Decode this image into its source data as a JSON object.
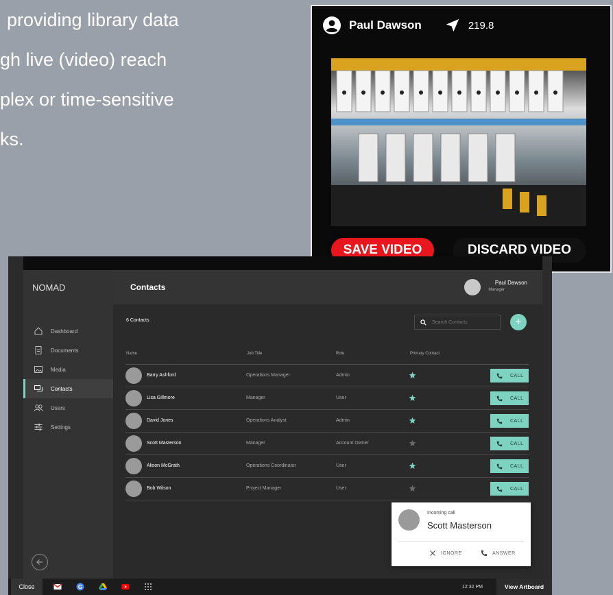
{
  "intro": {
    "lines": [
      "providing library data",
      "gh live (video) reach",
      "plex or time-sensitive",
      "ks."
    ]
  },
  "video": {
    "user_name": "Paul Dawson",
    "distance": "219.8",
    "save_label": "SAVE VIDEO",
    "discard_label": "DISCARD VIDEO",
    "icons": [
      "account-circle-icon",
      "navigation-arrow-icon"
    ]
  },
  "app": {
    "brand": "NOMAD",
    "page_title": "Contacts",
    "user": {
      "name": "Paul Dawson",
      "role": "Manager"
    },
    "nav": [
      {
        "label": "Dashboard",
        "icon": "home-icon"
      },
      {
        "label": "Documents",
        "icon": "document-icon"
      },
      {
        "label": "Media",
        "icon": "image-icon"
      },
      {
        "label": "Contacts",
        "icon": "chat-icon",
        "active": true
      },
      {
        "label": "Users",
        "icon": "users-icon"
      },
      {
        "label": "Settings",
        "icon": "sliders-icon"
      }
    ],
    "contacts_count": "6 Contacts",
    "search_placeholder": "Search Contacts",
    "add_label": "+",
    "columns": {
      "name": "Name",
      "job": "Job Title",
      "role": "Role",
      "primary": "Primary Contact"
    },
    "call_label": "CALL",
    "rows": [
      {
        "name": "Barry Ashford",
        "job": "Operations Manager",
        "role": "Admin",
        "primary": true
      },
      {
        "name": "Lisa Gillmore",
        "job": "Manager",
        "role": "User",
        "primary": true
      },
      {
        "name": "David Jones",
        "job": "Operations Analyst",
        "role": "Admin",
        "primary": true
      },
      {
        "name": "Scott Masterson",
        "job": "Manager",
        "role": "Account Owner",
        "primary": false
      },
      {
        "name": "Alison McGrath",
        "job": "Operations Coordinator",
        "role": "User",
        "primary": true
      },
      {
        "name": "Bob Wilson",
        "job": "Project Manager",
        "role": "User",
        "primary": false
      }
    ],
    "colors": {
      "accent": "#7ed3c0",
      "star_on": "#7ed3c0",
      "star_off": "#6a6a6a"
    }
  },
  "incoming": {
    "label": "Incoming call",
    "name": "Scott Masterson",
    "ignore_label": "IGNORE",
    "answer_label": "ANSWER"
  },
  "taskbar": {
    "close_label": "Close",
    "time": "12:32 PM",
    "view_label": "View Artboard",
    "icons": [
      "gmail-icon",
      "google-icon",
      "drive-icon",
      "youtube-icon",
      "apps-grid-icon"
    ]
  }
}
